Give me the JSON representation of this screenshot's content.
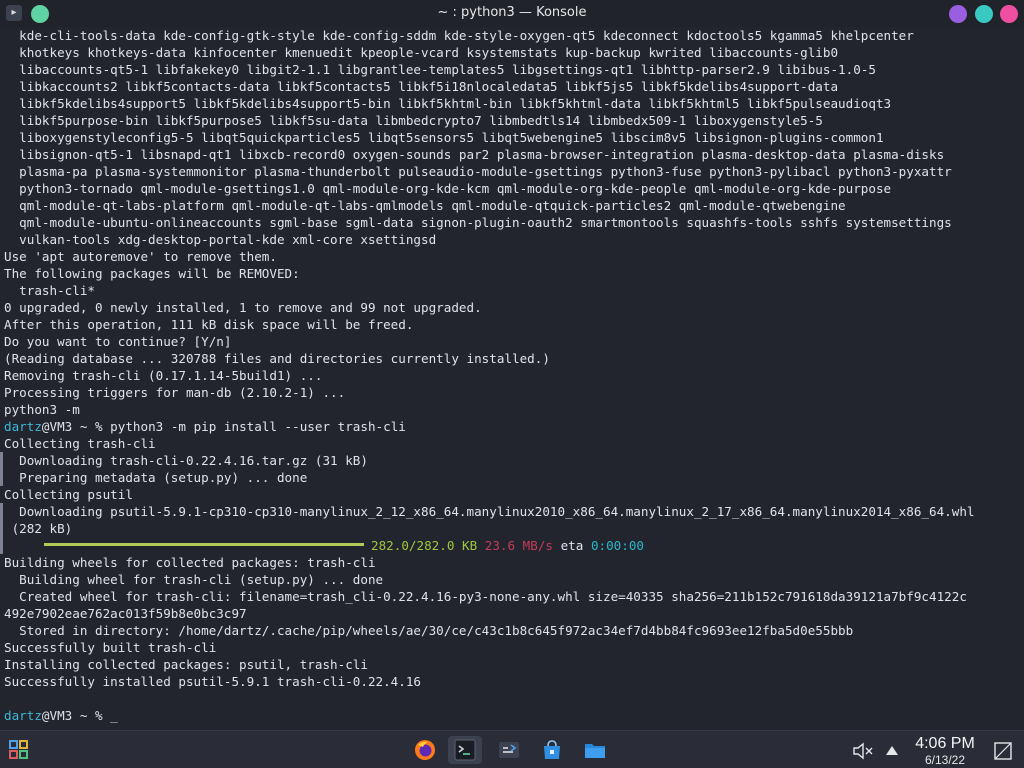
{
  "window": {
    "title": "~ : python3 — Konsole",
    "app_icon": "konsole-icon",
    "pin_icon": "pin-icon",
    "minimize_icon": "minimize-icon",
    "maximize_icon": "maximize-icon",
    "close_icon": "close-icon"
  },
  "terminal": {
    "prompt_user": "dartz",
    "prompt_host_suffix": "@VM3 ~ % ",
    "lines": [
      "  kde-cli-tools-data kde-config-gtk-style kde-config-sddm kde-style-oxygen-qt5 kdeconnect kdoctools5 kgamma5 khelpcenter",
      "  khotkeys khotkeys-data kinfocenter kmenuedit kpeople-vcard ksystemstats kup-backup kwrited libaccounts-glib0",
      "  libaccounts-qt5-1 libfakekey0 libgit2-1.1 libgrantlee-templates5 libgsettings-qt1 libhttp-parser2.9 libibus-1.0-5",
      "  libkaccounts2 libkf5contacts-data libkf5contacts5 libkf5i18nlocaledata5 libkf5js5 libkf5kdelibs4support-data",
      "  libkf5kdelibs4support5 libkf5kdelibs4support5-bin libkf5khtml-bin libkf5khtml-data libkf5khtml5 libkf5pulseaudioqt3",
      "  libkf5purpose-bin libkf5purpose5 libkf5su-data libmbedcrypto7 libmbedtls14 libmbedx509-1 liboxygenstyle5-5",
      "  liboxygenstyleconfig5-5 libqt5quickparticles5 libqt5sensors5 libqt5webengine5 libscim8v5 libsignon-plugins-common1",
      "  libsignon-qt5-1 libsnapd-qt1 libxcb-record0 oxygen-sounds par2 plasma-browser-integration plasma-desktop-data plasma-disks",
      "  plasma-pa plasma-systemmonitor plasma-thunderbolt pulseaudio-module-gsettings python3-fuse python3-pylibacl python3-pyxattr",
      "  python3-tornado qml-module-gsettings1.0 qml-module-org-kde-kcm qml-module-org-kde-people qml-module-org-kde-purpose",
      "  qml-module-qt-labs-platform qml-module-qt-labs-qmlmodels qml-module-qtquick-particles2 qml-module-qtwebengine",
      "  qml-module-ubuntu-onlineaccounts sgml-base sgml-data signon-plugin-oauth2 smartmontools squashfs-tools sshfs systemsettings",
      "  vulkan-tools xdg-desktop-portal-kde xml-core xsettingsd",
      "Use 'apt autoremove' to remove them.",
      "The following packages will be REMOVED:",
      "  trash-cli*",
      "0 upgraded, 0 newly installed, 1 to remove and 99 not upgraded.",
      "After this operation, 111 kB disk space will be freed.",
      "Do you want to continue? [Y/n]",
      "(Reading database ... 320788 files and directories currently installed.)",
      "Removing trash-cli (0.17.1.14-5build1) ...",
      "Processing triggers for man-db (2.10.2-1) ...",
      "python3 -m"
    ],
    "command": "python3 -m pip install --user trash-cli",
    "pip_lines": [
      "Collecting trash-cli",
      "  Downloading trash-cli-0.22.4.16.tar.gz (31 kB)",
      "  Preparing metadata (setup.py) ... done",
      "Collecting psutil",
      "  Downloading psutil-5.9.1-cp310-cp310-manylinux_2_12_x86_64.manylinux2010_x86_64.manylinux_2_17_x86_64.manylinux2014_x86_64.whl",
      " (282 kB)"
    ],
    "progress": {
      "fraction": 1.0,
      "done": "282.0/282.0 KB",
      "speed": "23.6 MB/s",
      "eta_label": "eta",
      "eta": "0:00:00"
    },
    "build_lines": [
      "Building wheels for collected packages: trash-cli",
      "  Building wheel for trash-cli (setup.py) ... done",
      "  Created wheel for trash-cli: filename=trash_cli-0.22.4.16-py3-none-any.whl size=40335 sha256=211b152c791618da39121a7bf9c4122c",
      "492e7902eae762ac013f59b8e0bc3c97",
      "  Stored in directory: /home/dartz/.cache/pip/wheels/ae/30/ce/c43c1b8c645f972ac34ef7d4bb84fc9693ee12fba5d0e55bbb",
      "Successfully built trash-cli",
      "Installing collected packages: psutil, trash-cli",
      "Successfully installed psutil-5.9.1 trash-cli-0.22.4.16"
    ],
    "cursor": "_"
  },
  "taskbar": {
    "launcher_icon": "app-launcher-icon",
    "tasks": [
      {
        "name": "firefox-icon"
      },
      {
        "name": "konsole-icon"
      },
      {
        "name": "discover-icon"
      },
      {
        "name": "store-icon"
      },
      {
        "name": "files-icon"
      }
    ],
    "tray": {
      "volume_icon": "volume-muted-icon",
      "expand_icon": "chevron-up-icon"
    },
    "clock": {
      "time": "4:06 PM",
      "date": "6/13/22"
    },
    "show_desktop_icon": "show-desktop-icon"
  },
  "colors": {
    "terminal_bg": "#23252e",
    "prompt_user": "#3fb7d6",
    "progress_bar": "#b5c957",
    "progress_done": "#9ec63d",
    "progress_speed": "#c23d57",
    "progress_eta": "#2ab7c9"
  }
}
